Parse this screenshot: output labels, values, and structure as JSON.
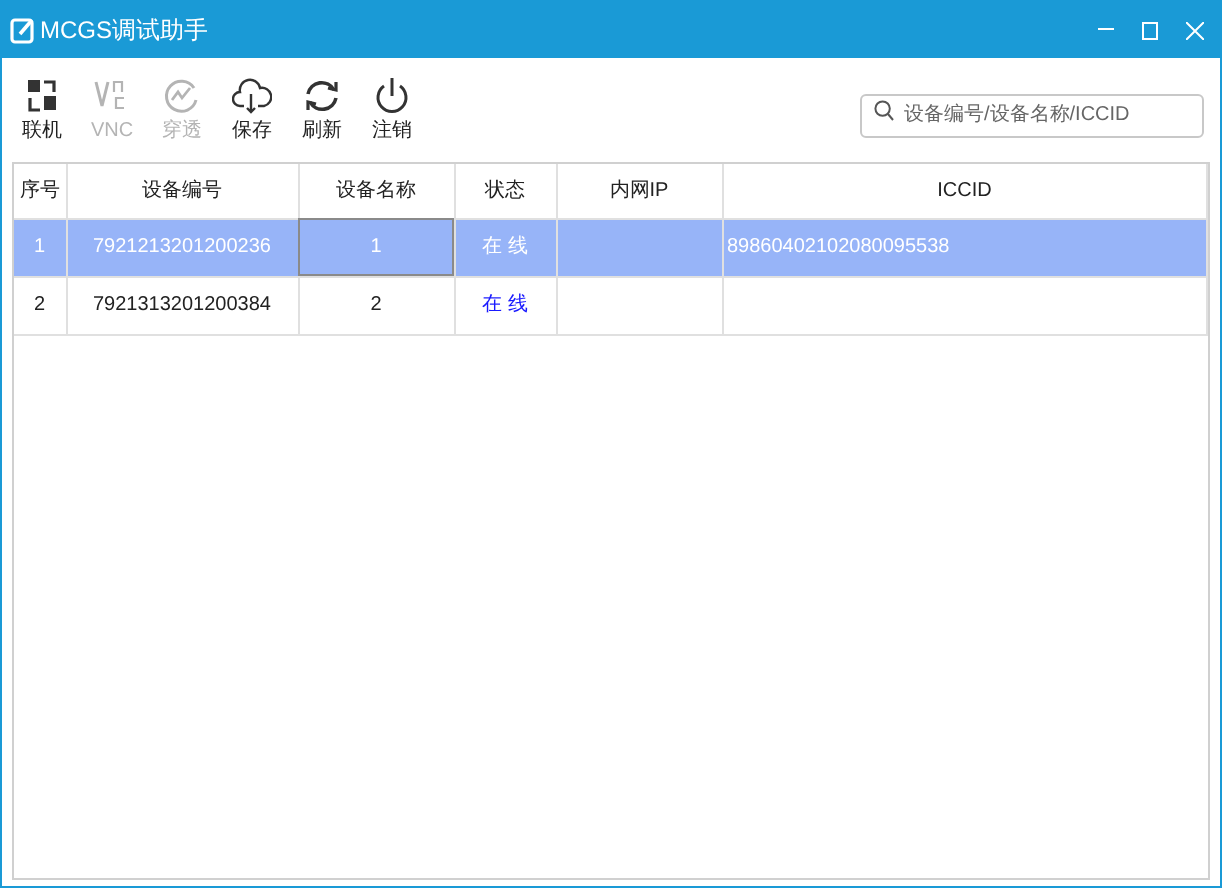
{
  "window": {
    "title": "MCGS调试助手"
  },
  "toolbar": [
    {
      "kind": "connect",
      "label": "联机",
      "disabled": false
    },
    {
      "kind": "vnc",
      "label": "VNC",
      "disabled": true
    },
    {
      "kind": "tunnel",
      "label": "穿透",
      "disabled": true
    },
    {
      "kind": "save",
      "label": "保存",
      "disabled": false
    },
    {
      "kind": "refresh",
      "label": "刷新",
      "disabled": false
    },
    {
      "kind": "logout",
      "label": "注销",
      "disabled": false
    }
  ],
  "search": {
    "placeholder": "设备编号/设备名称/ICCID"
  },
  "table": {
    "columns": [
      "序号",
      "设备编号",
      "设备名称",
      "状态",
      "内网IP",
      "ICCID"
    ],
    "rows": [
      {
        "selected": true,
        "cells": [
          "1",
          "7921213201200236",
          "1",
          "在 线",
          "",
          "89860402102080095538"
        ]
      },
      {
        "selected": false,
        "cells": [
          "2",
          "7921313201200384",
          "2",
          "在 线",
          "",
          ""
        ]
      }
    ]
  }
}
